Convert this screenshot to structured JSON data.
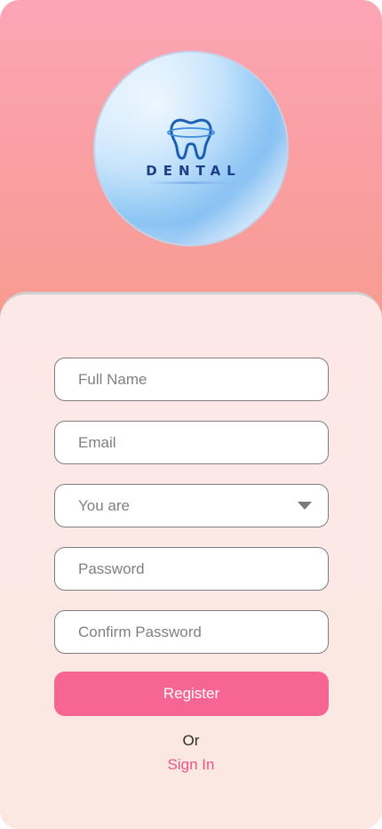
{
  "logo": {
    "brand_text": "DENTAL",
    "icon": "tooth-icon"
  },
  "form": {
    "full_name_placeholder": "Full Name",
    "email_placeholder": "Email",
    "role_select_placeholder": "You are",
    "password_placeholder": "Password",
    "confirm_password_placeholder": "Confirm Password"
  },
  "actions": {
    "register_label": "Register",
    "or_text": "Or",
    "signin_label": "Sign In"
  },
  "colors": {
    "header_gradient_top": "#fca5b5",
    "header_gradient_bottom": "#f59a90",
    "card_background": "#fde8e8",
    "register_button": "#f66594",
    "signin_link": "#f0528a",
    "brand_text": "#1a3f86"
  }
}
